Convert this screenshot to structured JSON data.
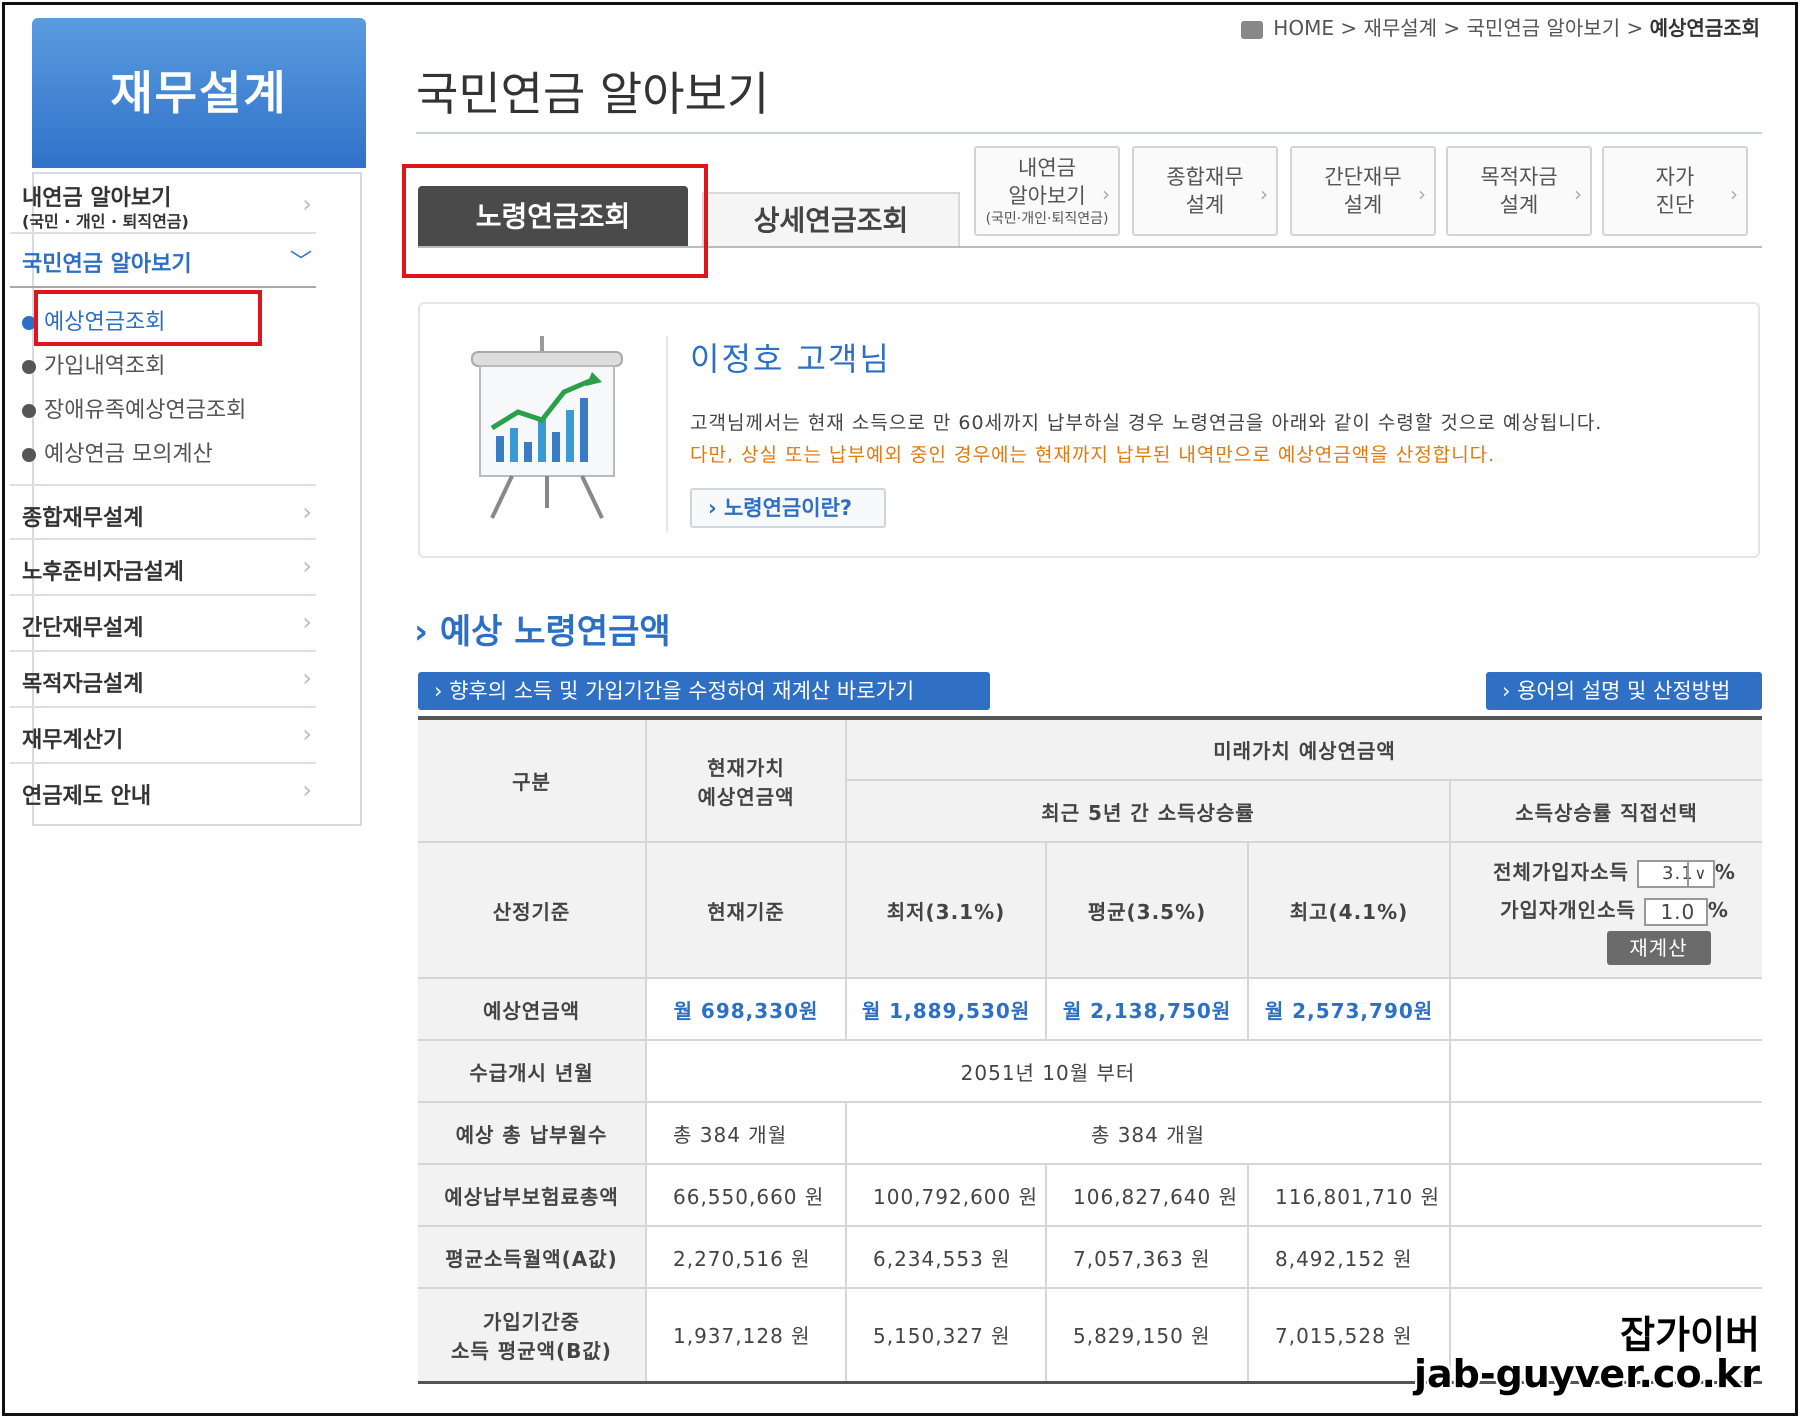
{
  "sidebar": {
    "header": "재무설계",
    "items": [
      {
        "label": "내연금 알아보기",
        "sub": "(국민 · 개인 · 퇴직연금)"
      },
      {
        "label": "국민연금 알아보기"
      },
      {
        "label": "종합재무설계"
      },
      {
        "label": "노후준비자금설계"
      },
      {
        "label": "간단재무설계"
      },
      {
        "label": "목적자금설계"
      },
      {
        "label": "재무계산기"
      },
      {
        "label": "연금제도 안내"
      }
    ],
    "subitems": [
      "예상연금조회",
      "가입내역조회",
      "장애유족예상연금조회",
      "예상연금 모의계산"
    ]
  },
  "breadcrumb": {
    "home": "HOME",
    "l1": "재무설계",
    "l2": "국민연금 알아보기",
    "current": "예상연금조회",
    "sep": ">"
  },
  "page_title": "국민연금 알아보기",
  "tabs": {
    "active": "노령연금조회",
    "inactive": "상세연금조회"
  },
  "menu_tabs": [
    {
      "line1": "내연금",
      "line2": "알아보기",
      "line3": "(국민·개인·퇴직연금)"
    },
    {
      "line1": "종합재무",
      "line2": "설계"
    },
    {
      "line1": "간단재무",
      "line2": "설계"
    },
    {
      "line1": "목적자금",
      "line2": "설계"
    },
    {
      "line1": "자가",
      "line2": "진단"
    }
  ],
  "info": {
    "customer": "이정호 고객님",
    "line1": "고객님께서는 현재 소득으로 만 60세까지 납부하실 경우 노령연금을 아래와 같이 수령할 것으로 예상됩니다.",
    "line2": "다만, 상실 또는 납부예외 중인 경우에는 현재까지 납부된 내역만으로 예상연금액을 산정합니다.",
    "button": "› 노령연금이란?"
  },
  "section": {
    "title": "› 예상 노령연금액",
    "btn_recalc_link": "› 향후의 소득 및 가입기간을 수정하여 재계산 바로가기",
    "btn_terms": "› 용어의 설명 및 산정방법"
  },
  "table": {
    "h_gubun": "구분",
    "h_present_1": "현재가치",
    "h_present_2": "예상연금액",
    "h_future": "미래가치 예상연금액",
    "h_recent": "최근 5년 간 소득상승률",
    "h_direct": "소득상승률 직접선택",
    "r_basis": "산정기준",
    "basis": [
      "현재기준",
      "최저(3.1%)",
      "평균(3.5%)",
      "최고(4.1%)"
    ],
    "ctrl": {
      "all_label": "전체가입자소득",
      "all_value": "3.1",
      "pct": "%",
      "personal_label": "가입자개인소득",
      "personal_value": "1.0",
      "recalc": "재계산"
    },
    "r_amount": "예상연금액",
    "amounts": [
      "월 698,330원",
      "월 1,889,530원",
      "월 2,138,750원",
      "월 2,573,790원"
    ],
    "r_start": "수급개시 년월",
    "start": "2051년 10월 부터",
    "r_months": "예상 총 납부월수",
    "months_present": "총 384 개월",
    "months_future": "총 384 개월",
    "r_premium": "예상납부보험료총액",
    "premium": [
      "66,550,660 원",
      "100,792,600 원",
      "106,827,640 원",
      "116,801,710 원"
    ],
    "r_avg_a": "평균소득월액(A값)",
    "avg_a": [
      "2,270,516 원",
      "6,234,553 원",
      "7,057,363 원",
      "8,492,152 원"
    ],
    "r_avg_b1": "가입기간중",
    "r_avg_b2": "소득 평균액(B값)",
    "avg_b": [
      "1,937,128 원",
      "5,150,327 원",
      "5,829,150 원",
      "7,015,528 원"
    ]
  },
  "watermark": {
    "line1": "잡가이버",
    "line2": "jab-guyver.co.kr"
  },
  "colors": {
    "accent": "#2c6fc5",
    "highlight_box": "#e0141b",
    "active_tab": "#4a4a4a",
    "orange_text": "#e07a10"
  }
}
